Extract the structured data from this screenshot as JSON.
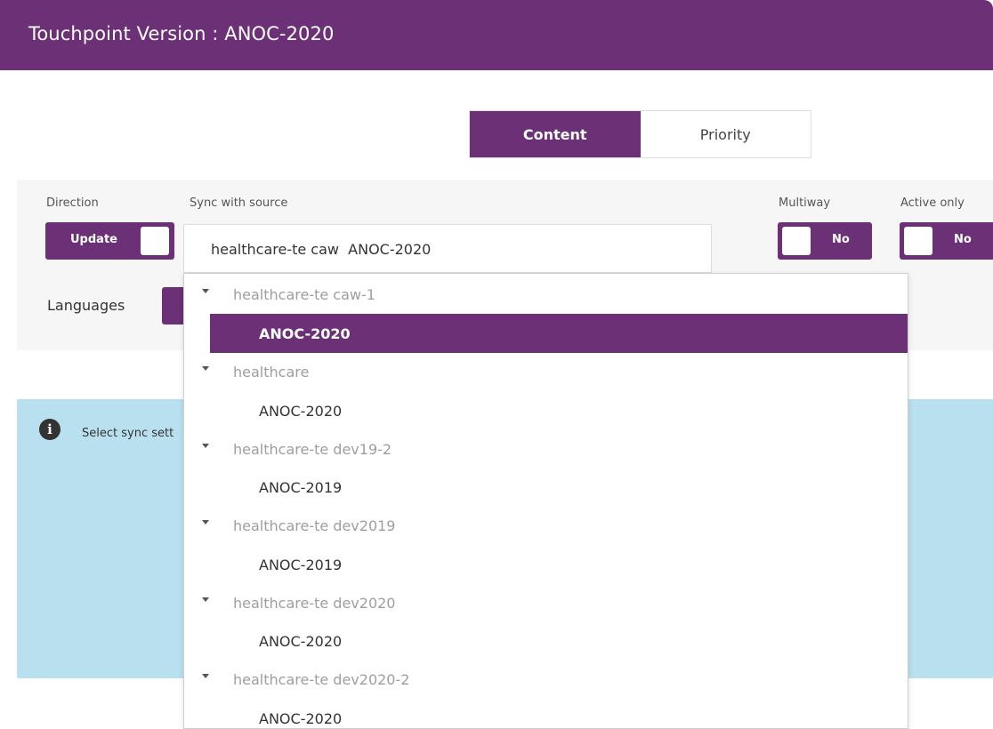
{
  "header": {
    "title": "Touchpoint Version : ANOC-2020"
  },
  "tabs": [
    {
      "label": "Content",
      "active": true
    },
    {
      "label": "Priority",
      "active": false
    }
  ],
  "settings": {
    "direction_label": "Direction",
    "direction_value": "Update",
    "sync_label": "Sync with source",
    "sync_value": "healthcare-te caw  ANOC-2020",
    "multiway_label": "Multiway",
    "multiway_value": "No",
    "active_only_label": "Active only",
    "active_only_value": "No",
    "languages_label": "Languages"
  },
  "info": {
    "text": "Select sync sett"
  },
  "dropdown": {
    "groups": [
      {
        "label": "healthcare-te caw-1",
        "options": [
          "ANOC-2020"
        ]
      },
      {
        "label": "healthcare",
        "options": [
          "ANOC-2020"
        ]
      },
      {
        "label": "healthcare-te dev19-2",
        "options": [
          "ANOC-2019"
        ]
      },
      {
        "label": "healthcare-te dev2019",
        "options": [
          "ANOC-2019"
        ]
      },
      {
        "label": "healthcare-te dev2020",
        "options": [
          "ANOC-2020"
        ]
      },
      {
        "label": "healthcare-te dev2020-2",
        "options": [
          "ANOC-2020"
        ]
      }
    ]
  },
  "colors": {
    "brand": "#6b3076",
    "info_bg": "#b9e0ee",
    "panel_bg": "#f6f6f6"
  }
}
